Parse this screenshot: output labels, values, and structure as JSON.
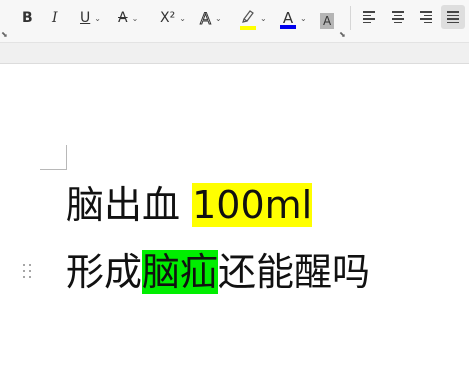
{
  "toolbar": {
    "bold_label": "B",
    "italic_label": "I",
    "underline_label": "U",
    "strikethrough_label": "A",
    "superscript_label": "X²",
    "text_effect_label": "A",
    "font_color_label": "A",
    "char_shading_label": "A",
    "highlight_color": "#ffff00",
    "font_color": "#0000ee",
    "caret": "⌄"
  },
  "document": {
    "line1_text": "脑出血 ",
    "line1_highlight": "100ml",
    "line2_prefix": "形成",
    "line2_highlight": "脑疝",
    "line2_suffix": "还能醒吗"
  },
  "colors": {
    "yellow_highlight": "#ffff00",
    "green_highlight": "#00ee00"
  }
}
